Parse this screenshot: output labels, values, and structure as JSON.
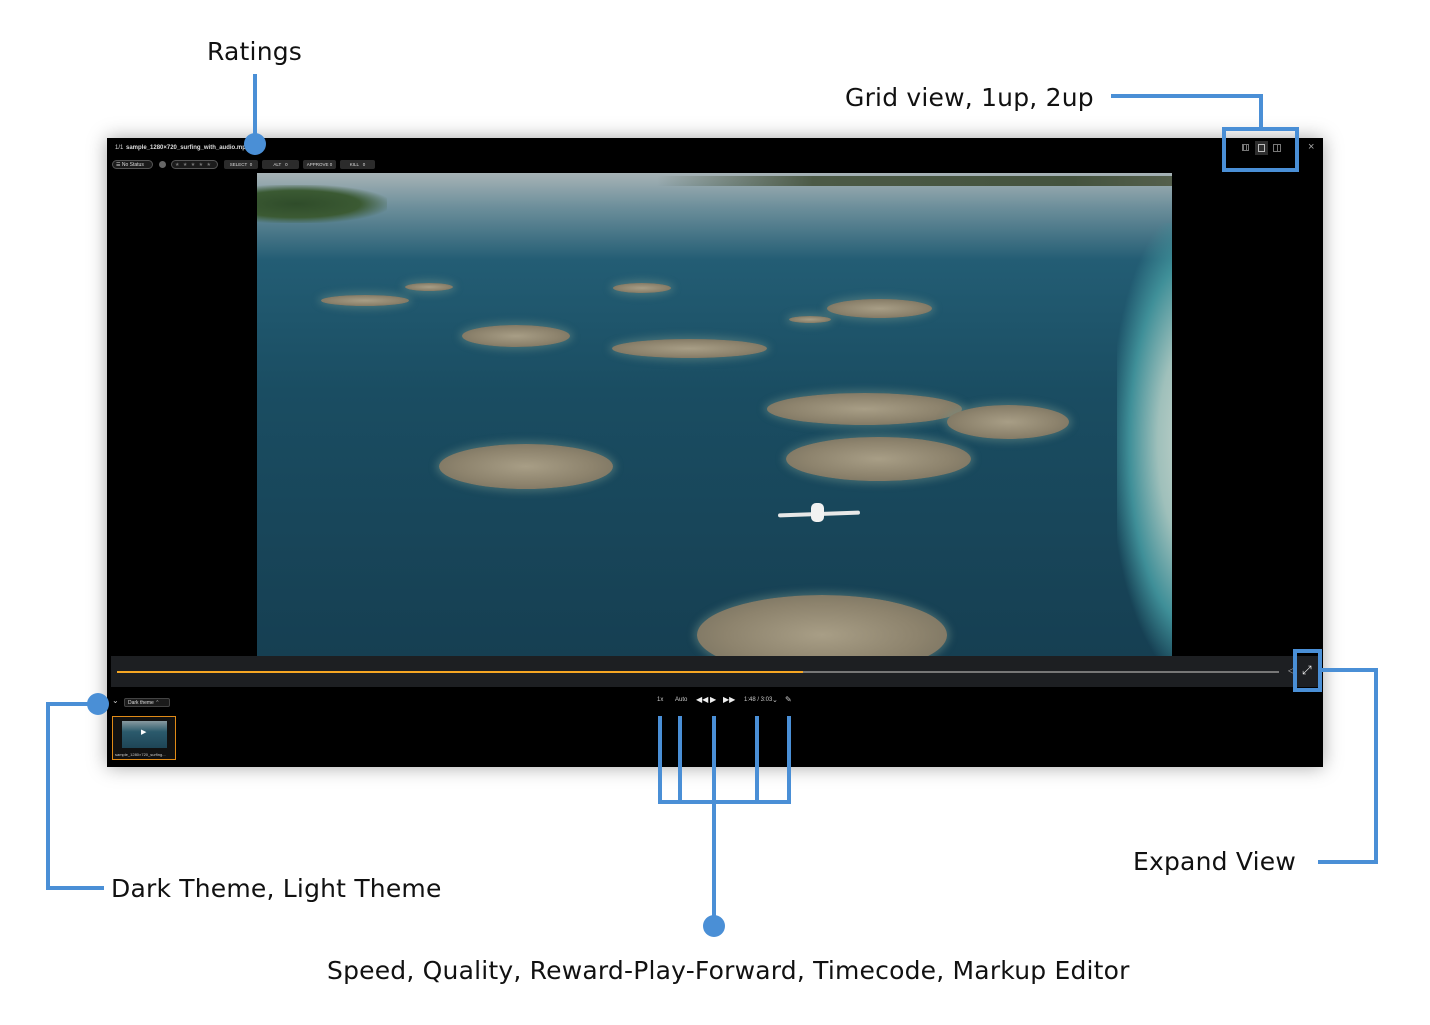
{
  "annotations": {
    "ratings": "Ratings",
    "grid_views": "Grid view, 1up, 2up",
    "expand_view": "Expand View",
    "themes": "Dark Theme, Light Theme",
    "playback": "Speed, Quality, Reward-Play-Forward, Timecode, Markup Editor"
  },
  "viewer": {
    "counter": "1/1",
    "filename": "sample_1280×720_surfing_with_audio.mp4",
    "status_label": "No Status",
    "stars": "★ ★ ★ ★ ★",
    "flags": [
      {
        "label": "SELECT",
        "count": "0"
      },
      {
        "label": "ALT",
        "count": "0"
      },
      {
        "label": "APPROVE",
        "count": "0"
      },
      {
        "label": "KILL",
        "count": "0"
      }
    ],
    "close_icon": "close-icon",
    "view_icons": [
      "grid-view-icon",
      "one-up-icon",
      "two-up-icon"
    ]
  },
  "player": {
    "progress": 0.59,
    "progress_color": "#f5a623",
    "speed": "1x",
    "quality": "Auto",
    "timecode": "1:48 / 3:03",
    "theme_select": "Dark theme",
    "thumbnail_caption": "sample_1280×720_surfing...",
    "accent": "#4a8fd6"
  }
}
